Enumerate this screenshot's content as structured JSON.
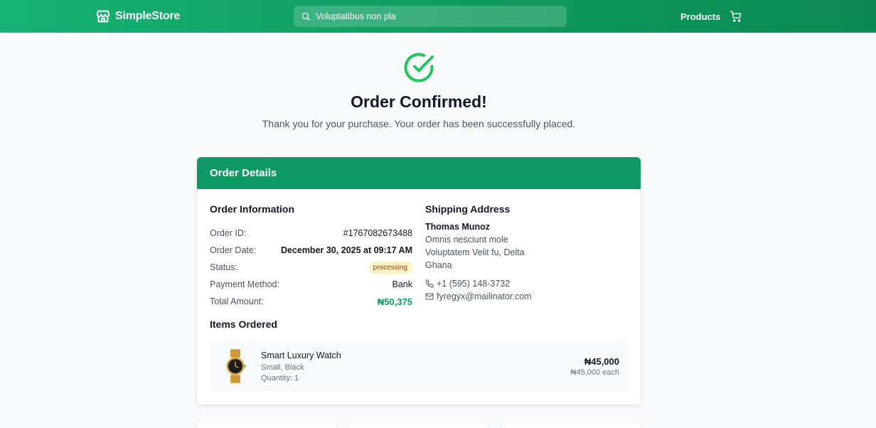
{
  "header": {
    "brand": "SimpleStore",
    "search_value": "Voluptatibus non pla",
    "nav_products": "Products",
    "icons": {
      "logo": "store-icon",
      "search": "search-icon",
      "cart": "cart-icon"
    }
  },
  "confirmation": {
    "icon": "check-circle-icon",
    "title": "Order Confirmed!",
    "subtitle": "Thank you for your purchase. Your order has been successfully placed."
  },
  "order_details": {
    "heading": "Order Details",
    "info": {
      "title": "Order Information",
      "rows": [
        {
          "label": "Order ID:",
          "value": "#1767082673488"
        },
        {
          "label": "Order Date:",
          "value": "December 30, 2025 at 09:17 AM"
        },
        {
          "label": "Status:",
          "value": "processing"
        },
        {
          "label": "Payment Method:",
          "value": "Bank"
        },
        {
          "label": "Total Amount:",
          "value": "₦50,375"
        }
      ]
    },
    "shipping": {
      "title": "Shipping Address",
      "name": "Thomas Munoz",
      "address_lines": [
        "Omnis nesciunt mole",
        "Voluptatem Velit fu, Delta",
        "Ghana"
      ],
      "phone": "+1 (595) 148-3732",
      "email": "fyregyx@mailinator.com"
    },
    "items_title": "Items Ordered",
    "items": [
      {
        "name": "Smart Luxury Watch",
        "variant": "Small, Black",
        "quantity": "Quantity: 1",
        "price": "₦45,000",
        "each": "₦45,000 each"
      }
    ]
  },
  "colors": {
    "brand_green": "#0e9a62",
    "check_green": "#22c55e",
    "badge_bg": "#fef3c7",
    "badge_text": "#92400e"
  }
}
